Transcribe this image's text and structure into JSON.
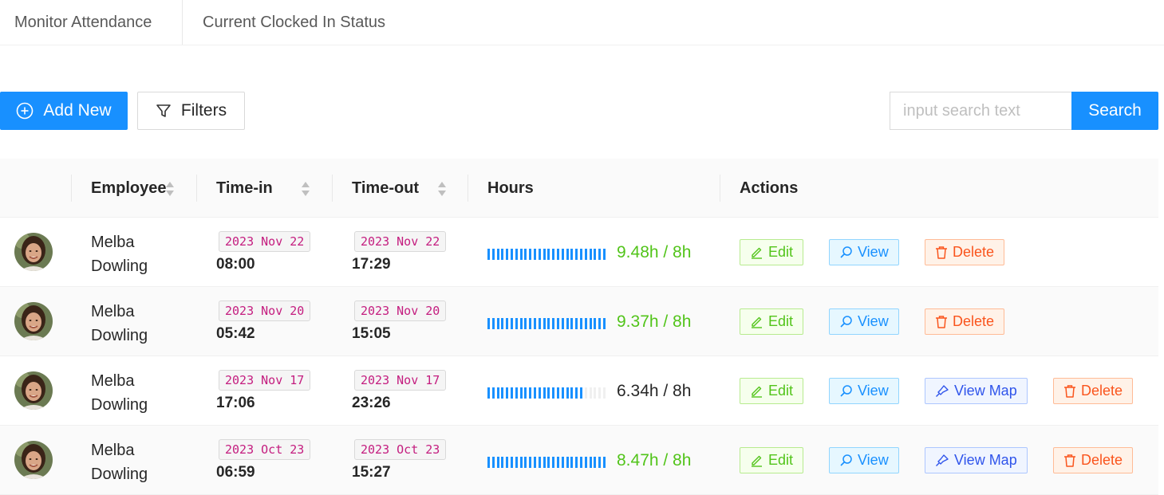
{
  "tabs": [
    {
      "label": "Monitor Attendance"
    },
    {
      "label": "Current Clocked In Status"
    }
  ],
  "toolbar": {
    "add_label": "Add New",
    "filters_label": "Filters",
    "search_placeholder": "input search text",
    "search_label": "Search"
  },
  "table": {
    "headers": {
      "employee": "Employee",
      "time_in": "Time-in",
      "time_out": "Time-out",
      "hours": "Hours",
      "actions": "Actions"
    },
    "action_labels": {
      "edit": "Edit",
      "view": "View",
      "view_map": "View Map",
      "delete": "Delete"
    },
    "rows": [
      {
        "first": "Melba",
        "last": "Dowling",
        "in_date": "2023 Nov 22",
        "in_time": "08:00",
        "out_date": "2023 Nov 22",
        "out_time": "17:29",
        "hours_text": "9.48h / 8h",
        "hours_fraction": 1.0,
        "has_map": false
      },
      {
        "first": "Melba",
        "last": "Dowling",
        "in_date": "2023 Nov 20",
        "in_time": "05:42",
        "out_date": "2023 Nov 20",
        "out_time": "15:05",
        "hours_text": "9.37h / 8h",
        "hours_fraction": 1.0,
        "has_map": false
      },
      {
        "first": "Melba",
        "last": "Dowling",
        "in_date": "2023 Nov 17",
        "in_time": "17:06",
        "out_date": "2023 Nov 17",
        "out_time": "23:26",
        "hours_text": "6.34h / 8h",
        "hours_fraction": 0.79,
        "has_map": true
      },
      {
        "first": "Melba",
        "last": "Dowling",
        "in_date": "2023 Oct 23",
        "in_time": "06:59",
        "out_date": "2023 Oct 23",
        "out_time": "15:27",
        "hours_text": "8.47h / 8h",
        "hours_fraction": 1.0,
        "has_map": true
      }
    ]
  },
  "colors": {
    "primary": "#1890ff",
    "success": "#52c41a",
    "date_tag": "#c41d7f",
    "delete": "#fa541c",
    "map": "#2f54eb"
  }
}
